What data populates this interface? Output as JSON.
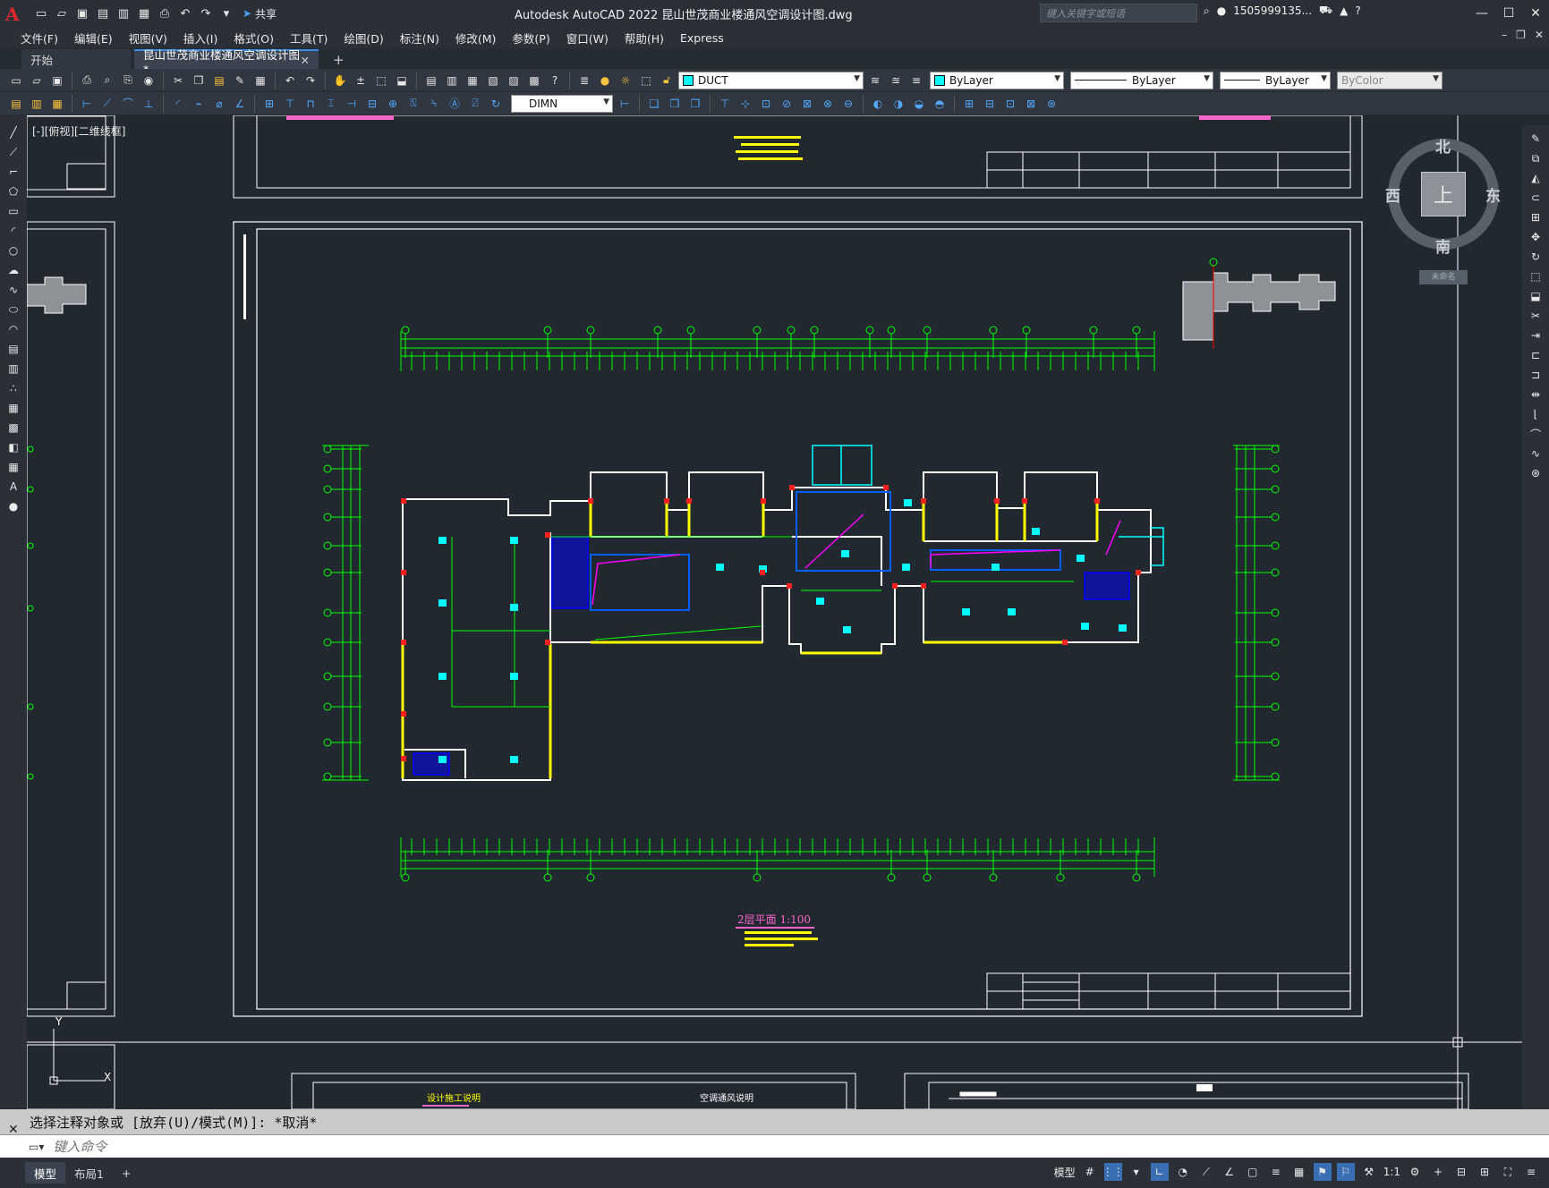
{
  "window": {
    "title": "Autodesk AutoCAD 2022    昆山世茂商业楼通风空调设计图.dwg",
    "app_logo": "A",
    "share_label": "共享",
    "search_placeholder": "键入关键字或短语",
    "user": "1505999135...",
    "controls": [
      "minimize-icon",
      "maximize-icon",
      "close-icon"
    ]
  },
  "menu": {
    "items": [
      "文件(F)",
      "编辑(E)",
      "视图(V)",
      "插入(I)",
      "格式(O)",
      "工具(T)",
      "绘图(D)",
      "标注(N)",
      "修改(M)",
      "参数(P)",
      "窗口(W)",
      "帮助(H)",
      "Express"
    ]
  },
  "tabs": {
    "start": "开始",
    "active": "昆山世茂商业楼通风空调设计图*"
  },
  "toolbar": {
    "layer": "DUCT",
    "color": "ByLayer",
    "linetype": "ByLayer",
    "lineweight": "ByLayer",
    "plotstyle": "ByColor",
    "dimstyle": "DIMN"
  },
  "viewport": {
    "label": "[-][俯视][二维线框]",
    "viewcube": {
      "north": "北",
      "south": "南",
      "east": "东",
      "west": "西",
      "top": "上",
      "ucs": "未命名"
    }
  },
  "drawing": {
    "plan_title": "2层平面   1:100",
    "axis_labels_top": [
      "1",
      "2",
      "3",
      "4",
      "5",
      "6",
      "7",
      "8",
      "9",
      "10",
      "11",
      "12",
      "13",
      "14",
      "15",
      "16"
    ],
    "sheet_label_left": "设计施工说明",
    "sheet_label_right": "空调通风说明"
  },
  "command": {
    "history": "选择注释对象或 [放弃(U)/模式(M)]: *取消*",
    "placeholder": "键入命令"
  },
  "status": {
    "model_tab": "模型",
    "layout_tab": "布局1",
    "model_label": "模型",
    "scale": "1:1"
  },
  "colors": {
    "background": "#212830",
    "frame": "#ffffff",
    "dim_green": "#00ff00",
    "cyan": "#00ffff",
    "yellow": "#ffff00",
    "magenta": "#ff00ff",
    "blue": "#0000ff"
  }
}
